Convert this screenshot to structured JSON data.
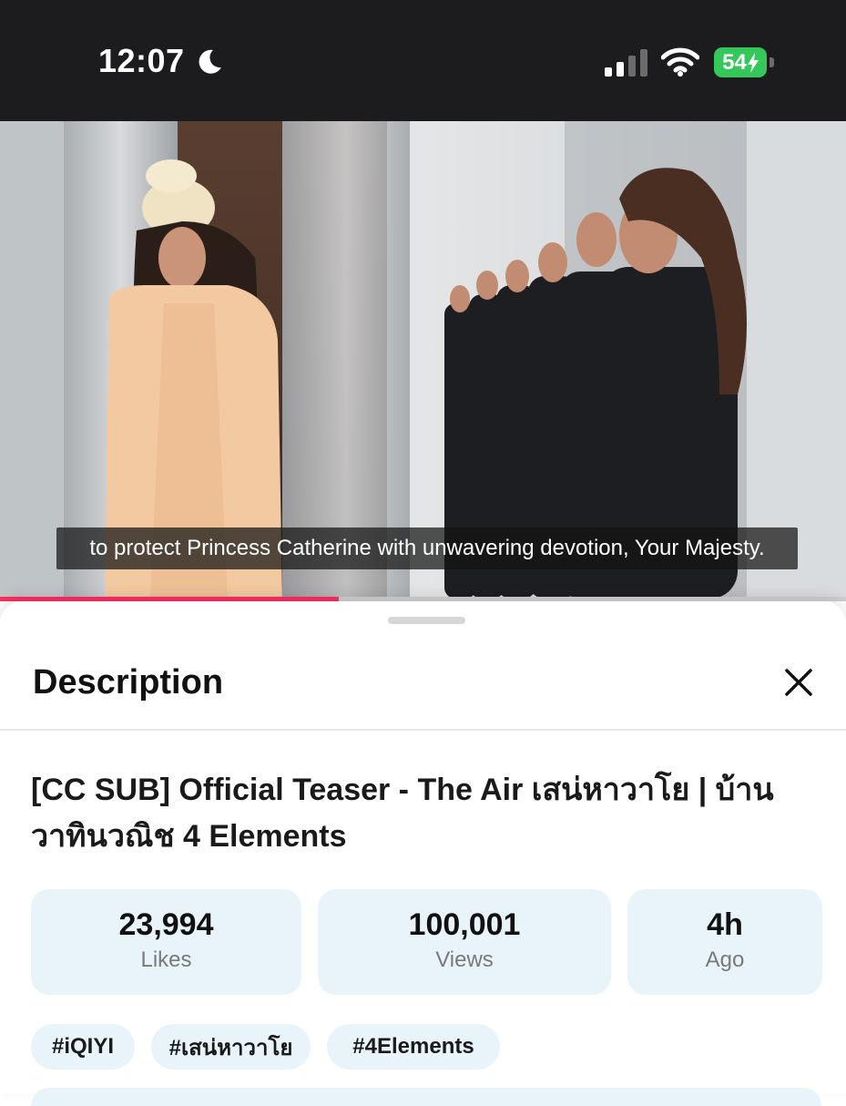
{
  "status_bar": {
    "time": "12:07",
    "battery": "54",
    "icons": [
      "moon-icon",
      "cellular-signal-icon",
      "wifi-icon",
      "battery-charging-icon"
    ]
  },
  "video": {
    "subtitle": "to protect Princess Catherine with unwavering devotion, Your Majesty.",
    "progress": 0.4
  },
  "sheet": {
    "title": "Description",
    "close_icon": "close-icon",
    "video_title": "[CC SUB] Official Teaser - The Air เสน่หาวาโย | บ้านวาทินวณิช 4 Elements",
    "stats": [
      {
        "value": "23,994",
        "label": "Likes"
      },
      {
        "value": "100,001",
        "label": "Views"
      },
      {
        "value": "4h",
        "label": "Ago"
      }
    ],
    "tags": [
      "#iQIYI",
      "#เสน่หาวาโย",
      "#4Elements"
    ]
  },
  "colors": {
    "accent": "#ff2e63",
    "card_bg": "#e8f4f9",
    "battery_green": "#34c759"
  }
}
